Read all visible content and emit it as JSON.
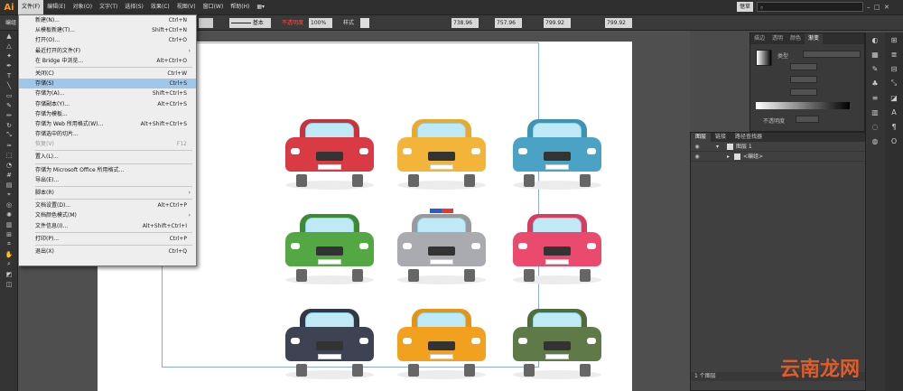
{
  "app": {
    "logo": "Ai"
  },
  "menubar": {
    "items": [
      "文件(F)",
      "编辑(E)",
      "对象(O)",
      "文字(T)",
      "选择(S)",
      "效果(C)",
      "视图(V)",
      "窗口(W)",
      "帮助(H)"
    ],
    "workspace": "惬草",
    "search_placeholder": "",
    "doc_arrange": "▦▾"
  },
  "controlbar": {
    "left_label": "编组",
    "stroke_label": "基本",
    "opacity_label": "不透明度",
    "opacity_value": "100%",
    "style_label": "样式",
    "x_value": "738.96 p",
    "y_value": "757.96 p",
    "w_value": "799.92 p",
    "h_value": "799.92 p"
  },
  "file_menu": {
    "items": [
      {
        "label": "新建(N)...",
        "shortcut": "Ctrl+N"
      },
      {
        "label": "从模板新建(T)...",
        "shortcut": "Shift+Ctrl+N"
      },
      {
        "label": "打开(O)...",
        "shortcut": "Ctrl+O"
      },
      {
        "label": "最近打开的文件(F)",
        "shortcut": "",
        "submenu": true
      },
      {
        "label": "在 Bridge 中浏览...",
        "shortcut": "Alt+Ctrl+O"
      },
      {
        "sep": true
      },
      {
        "label": "关闭(C)",
        "shortcut": "Ctrl+W"
      },
      {
        "label": "存储(S)",
        "shortcut": "Ctrl+S",
        "highlight": true
      },
      {
        "label": "存储为(A)...",
        "shortcut": "Shift+Ctrl+S"
      },
      {
        "label": "存储副本(Y)...",
        "shortcut": "Alt+Ctrl+S"
      },
      {
        "label": "存储为模板...",
        "shortcut": ""
      },
      {
        "label": "存储为 Web 所用格式(W)...",
        "shortcut": "Alt+Shift+Ctrl+S"
      },
      {
        "label": "存储选中的切片...",
        "shortcut": ""
      },
      {
        "label": "恢复(V)",
        "shortcut": "F12",
        "disabled": true
      },
      {
        "sep": true
      },
      {
        "label": "置入(L)...",
        "shortcut": ""
      },
      {
        "sep": true
      },
      {
        "label": "存储为 Microsoft Office 所用格式...",
        "shortcut": ""
      },
      {
        "label": "导出(E)...",
        "shortcut": ""
      },
      {
        "sep": true
      },
      {
        "label": "脚本(R)",
        "shortcut": "",
        "submenu": true
      },
      {
        "sep": true
      },
      {
        "label": "文档设置(D)...",
        "shortcut": "Alt+Ctrl+P"
      },
      {
        "label": "文档颜色模式(M)",
        "shortcut": "",
        "submenu": true
      },
      {
        "label": "文件信息(I)...",
        "shortcut": "Alt+Shift+Ctrl+I"
      },
      {
        "sep": true
      },
      {
        "label": "打印(P)...",
        "shortcut": "Ctrl+P"
      },
      {
        "sep": true
      },
      {
        "label": "退出(X)",
        "shortcut": "Ctrl+Q"
      }
    ]
  },
  "gradient_panel": {
    "tabs": [
      "描边",
      "透明",
      "颜色",
      "渐变"
    ],
    "type_label": "类型",
    "opacity_label": "不透明度"
  },
  "layers_panel": {
    "tabs": [
      "图层",
      "链接",
      "路径查找器"
    ],
    "rows": [
      {
        "name": "图层 1"
      },
      {
        "name": "<编组>"
      }
    ],
    "footer": "1 个图层"
  },
  "cars": [
    {
      "body": "#d93a44",
      "roof": "#c8323c"
    },
    {
      "body": "#f3b43a",
      "roof": "#eaa928"
    },
    {
      "body": "#4aa3c4",
      "roof": "#3e92b2"
    },
    {
      "body": "#53a843",
      "roof": "#3d8a35"
    },
    {
      "body": "#a9abb0",
      "roof": "#989aa0"
    },
    {
      "body": "#ea4a6d",
      "roof": "#d83c5f"
    },
    {
      "body": "#3d4352",
      "roof": "#323744"
    },
    {
      "body": "#f2a11f",
      "roof": "#e59414"
    },
    {
      "body": "#5f7a47",
      "roof": "#516b3b"
    }
  ],
  "watermark": "云南龙网"
}
